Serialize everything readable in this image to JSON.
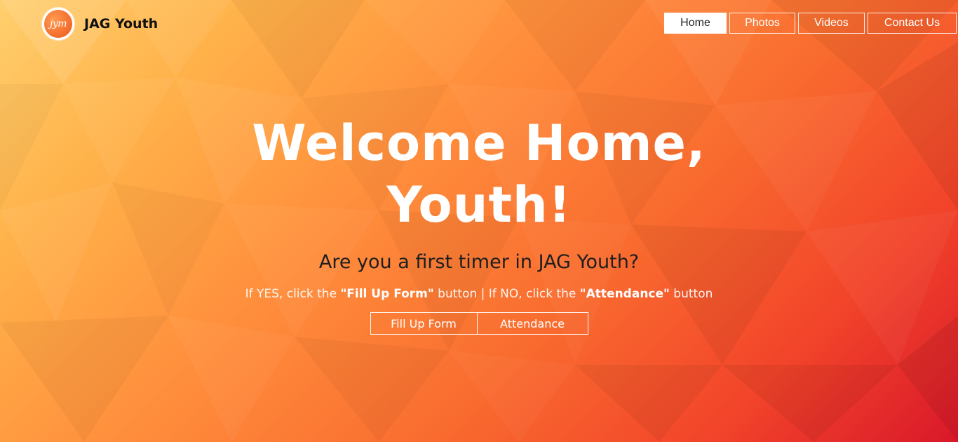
{
  "brand": {
    "logo_text": "jym",
    "name": "JAG Youth"
  },
  "nav": {
    "items": [
      {
        "label": "Home",
        "active": true
      },
      {
        "label": "Photos",
        "active": false
      },
      {
        "label": "Videos",
        "active": false
      },
      {
        "label": "Contact Us",
        "active": false
      }
    ]
  },
  "hero": {
    "title_line1": "Welcome Home,",
    "title_line2": "Youth!",
    "question": "Are you a first timer in JAG Youth?",
    "instructions": {
      "part1": "If YES, click the ",
      "highlight1": "\"Fill Up Form\"",
      "part2": " button | If NO, click the ",
      "highlight2": "\"Attendance\"",
      "part3": " button"
    },
    "buttons": {
      "fill_up_form": "Fill Up Form",
      "attendance": "Attendance"
    }
  },
  "colors": {
    "gradient_start": "#ffcf6e",
    "gradient_mid": "#ff8e3c",
    "gradient_end": "#d9182a",
    "text_dark": "#1e1e1e",
    "text_light": "#ffffff"
  }
}
